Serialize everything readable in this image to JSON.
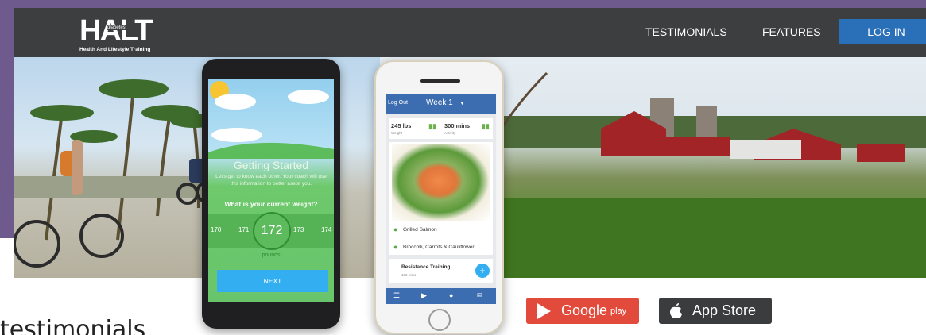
{
  "nav": {
    "logo": "HALT",
    "logo_mini": "diabetes",
    "logo_tagline": "Health And Lifestyle Training",
    "links": [
      "TESTIMONIALS",
      "FEATURES"
    ],
    "login": "LOG IN",
    "login_color": "#2a70b8",
    "bar_color": "#3d3e40"
  },
  "android_app": {
    "title": "Getting Started",
    "subtitle": "Let's get to know each other. Your coach will use this information to better assist you.",
    "question": "What is your current weight?",
    "picker": [
      "170",
      "171",
      "172",
      "173",
      "174"
    ],
    "selected": "172",
    "unit": "pounds",
    "next": "NEXT"
  },
  "iphone_app": {
    "logout": "Log Out",
    "week": "Week 1",
    "stats": [
      {
        "value": "245 lbs",
        "label": "Weight"
      },
      {
        "value": "300 mins",
        "label": "Activity"
      }
    ],
    "meal_items": [
      "Grilled Salmon",
      "Broccolli, Carrots & Cauliflower"
    ],
    "activity": "Resistance Training",
    "activity_detail": "180 mins"
  },
  "store_badges": {
    "google_play": "Google",
    "google_play_suffix": "play",
    "app_store": "App Store"
  },
  "lower_text": "testimonials"
}
